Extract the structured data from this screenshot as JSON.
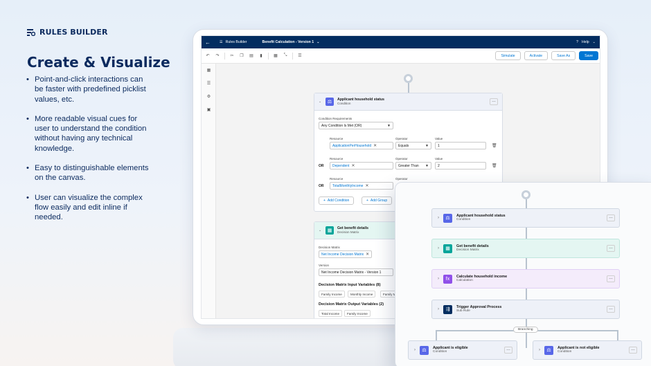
{
  "brand": {
    "name": "RULES BUILDER",
    "icon": "rules-builder-logo-icon"
  },
  "hero": {
    "title": "Create & Visualize",
    "bullets": [
      "Point-and-click interactions can be faster with predefined picklist values, etc.",
      "More readable visual cues for user to understand the condition without having any technical knowledge.",
      "Easy to distinguishable elements on the canvas.",
      "User can visualize the complex flow easily and edit inline if needed."
    ]
  },
  "app": {
    "app_name": "Rules Builder",
    "rule_title": "Benefit Calculation - Version 1",
    "help": "Help",
    "buttons": {
      "simulate": "Simulate",
      "activate": "Activate",
      "save_as": "Save As",
      "save": "Save"
    },
    "colors": {
      "topbar": "#032d60",
      "primary": "#0176d3"
    }
  },
  "condition_node": {
    "title": "Applicant household status",
    "subtitle": "Condition",
    "requirements_label": "Condition Requirements",
    "requirements_value": "Any Condition Is Met (OR)",
    "labels": {
      "resource": "Resource",
      "operator": "Operator",
      "value": "Value"
    },
    "rows": [
      {
        "prefix": "",
        "resource": "ApplicationPerHousehold",
        "operator": "Equals",
        "value": "1"
      },
      {
        "prefix": "OR",
        "resource": "Dependent",
        "operator": "Greater Than",
        "value": "2"
      },
      {
        "prefix": "OR",
        "resource": "TotalMonthlyIncome",
        "operator": "",
        "value": ""
      }
    ],
    "add_condition": "Add Condition",
    "add_group": "Add Group"
  },
  "matrix_node": {
    "title": "Get benefit details",
    "subtitle": "Decision Matrix",
    "matrix_label": "Decision Matrix",
    "matrix_value": "Net Income Decision Matrix",
    "version_label": "Version",
    "version_value": "Net Income Decision Matrix - Version 1",
    "input_heading": "Decision Matrix Input Variables (8)",
    "inputs": [
      "Family Income",
      "Monthly Income",
      "Family M"
    ],
    "output_heading": "Decision Matrix Output Variables (2)",
    "outputs": [
      "Total Income",
      "Family Income"
    ]
  },
  "flow": {
    "nodes": [
      {
        "title": "Applicant household status",
        "subtitle": "Condition",
        "icon": "condition-icon",
        "color": "#5867e8",
        "bg": "#eef1f8"
      },
      {
        "title": "Get benefit details",
        "subtitle": "Decision Matrix",
        "icon": "matrix-icon",
        "color": "#06a59a",
        "bg": "#e4f6f2"
      },
      {
        "title": "Calculate household income",
        "subtitle": "Calculation",
        "icon": "calculation-icon",
        "color": "#9050e9",
        "bg": "#f4ecfb"
      },
      {
        "title": "Trigger Approval Process",
        "subtitle": "Sub Rule",
        "icon": "subrule-icon",
        "color": "#032d60",
        "bg": "#eef1f8"
      }
    ],
    "branch_label": "Branching",
    "branches": [
      {
        "title": "Applicant is eligible",
        "subtitle": "Condition"
      },
      {
        "title": "Applicant is not eligible",
        "subtitle": "Condition"
      }
    ]
  }
}
